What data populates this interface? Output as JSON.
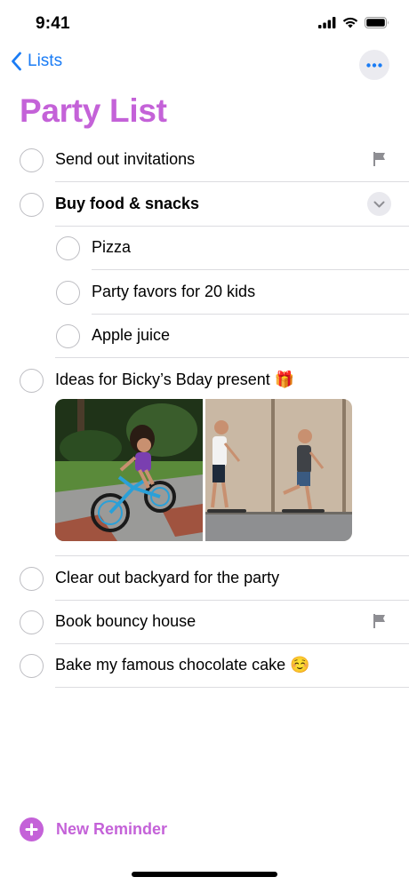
{
  "status_bar": {
    "time": "9:41"
  },
  "nav": {
    "back_label": "Lists"
  },
  "title": "Party List",
  "colors": {
    "accent": "#c462d8",
    "link": "#1a7cf5",
    "circle": "#bdbdc2",
    "divider": "#dcdce0",
    "flag": "#8e8e93"
  },
  "reminders": [
    {
      "label": "Send out invitations",
      "flagged": true
    },
    {
      "label": "Buy food & snacks",
      "expanded": true
    },
    {
      "label": "Pizza",
      "subtask": true
    },
    {
      "label": "Party favors for 20 kids",
      "subtask": true
    },
    {
      "label": "Apple juice",
      "subtask": true
    },
    {
      "label": "Ideas for Bicky’s Bday present",
      "emoji": "🎁"
    },
    {
      "label": "Clear out backyard for the party"
    },
    {
      "label": "Book bouncy house",
      "flagged": true
    },
    {
      "label": "Bake my famous chocolate cake",
      "emoji": "☺️"
    }
  ],
  "new_reminder_label": "New Reminder"
}
